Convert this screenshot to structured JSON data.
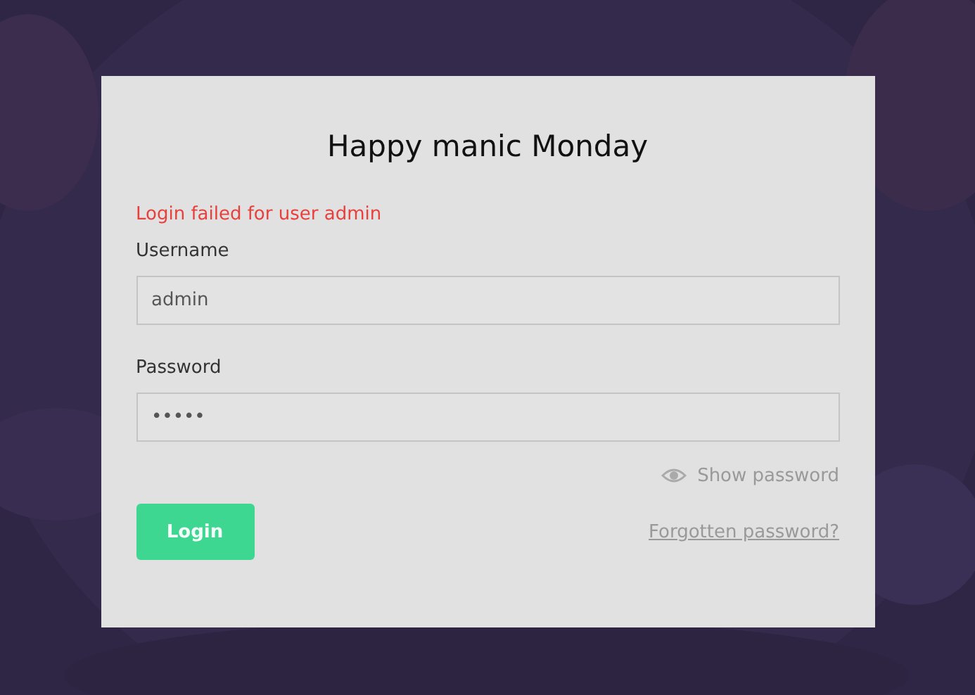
{
  "title": "Happy manic Monday",
  "error": "Login failed for user admin",
  "fields": [
    {
      "label": "Username",
      "value": "admin"
    },
    {
      "label": "Password",
      "value": "•••••"
    }
  ],
  "show_password": "Show password",
  "login_button": "Login",
  "forgot_link": "Forgotten password?"
}
